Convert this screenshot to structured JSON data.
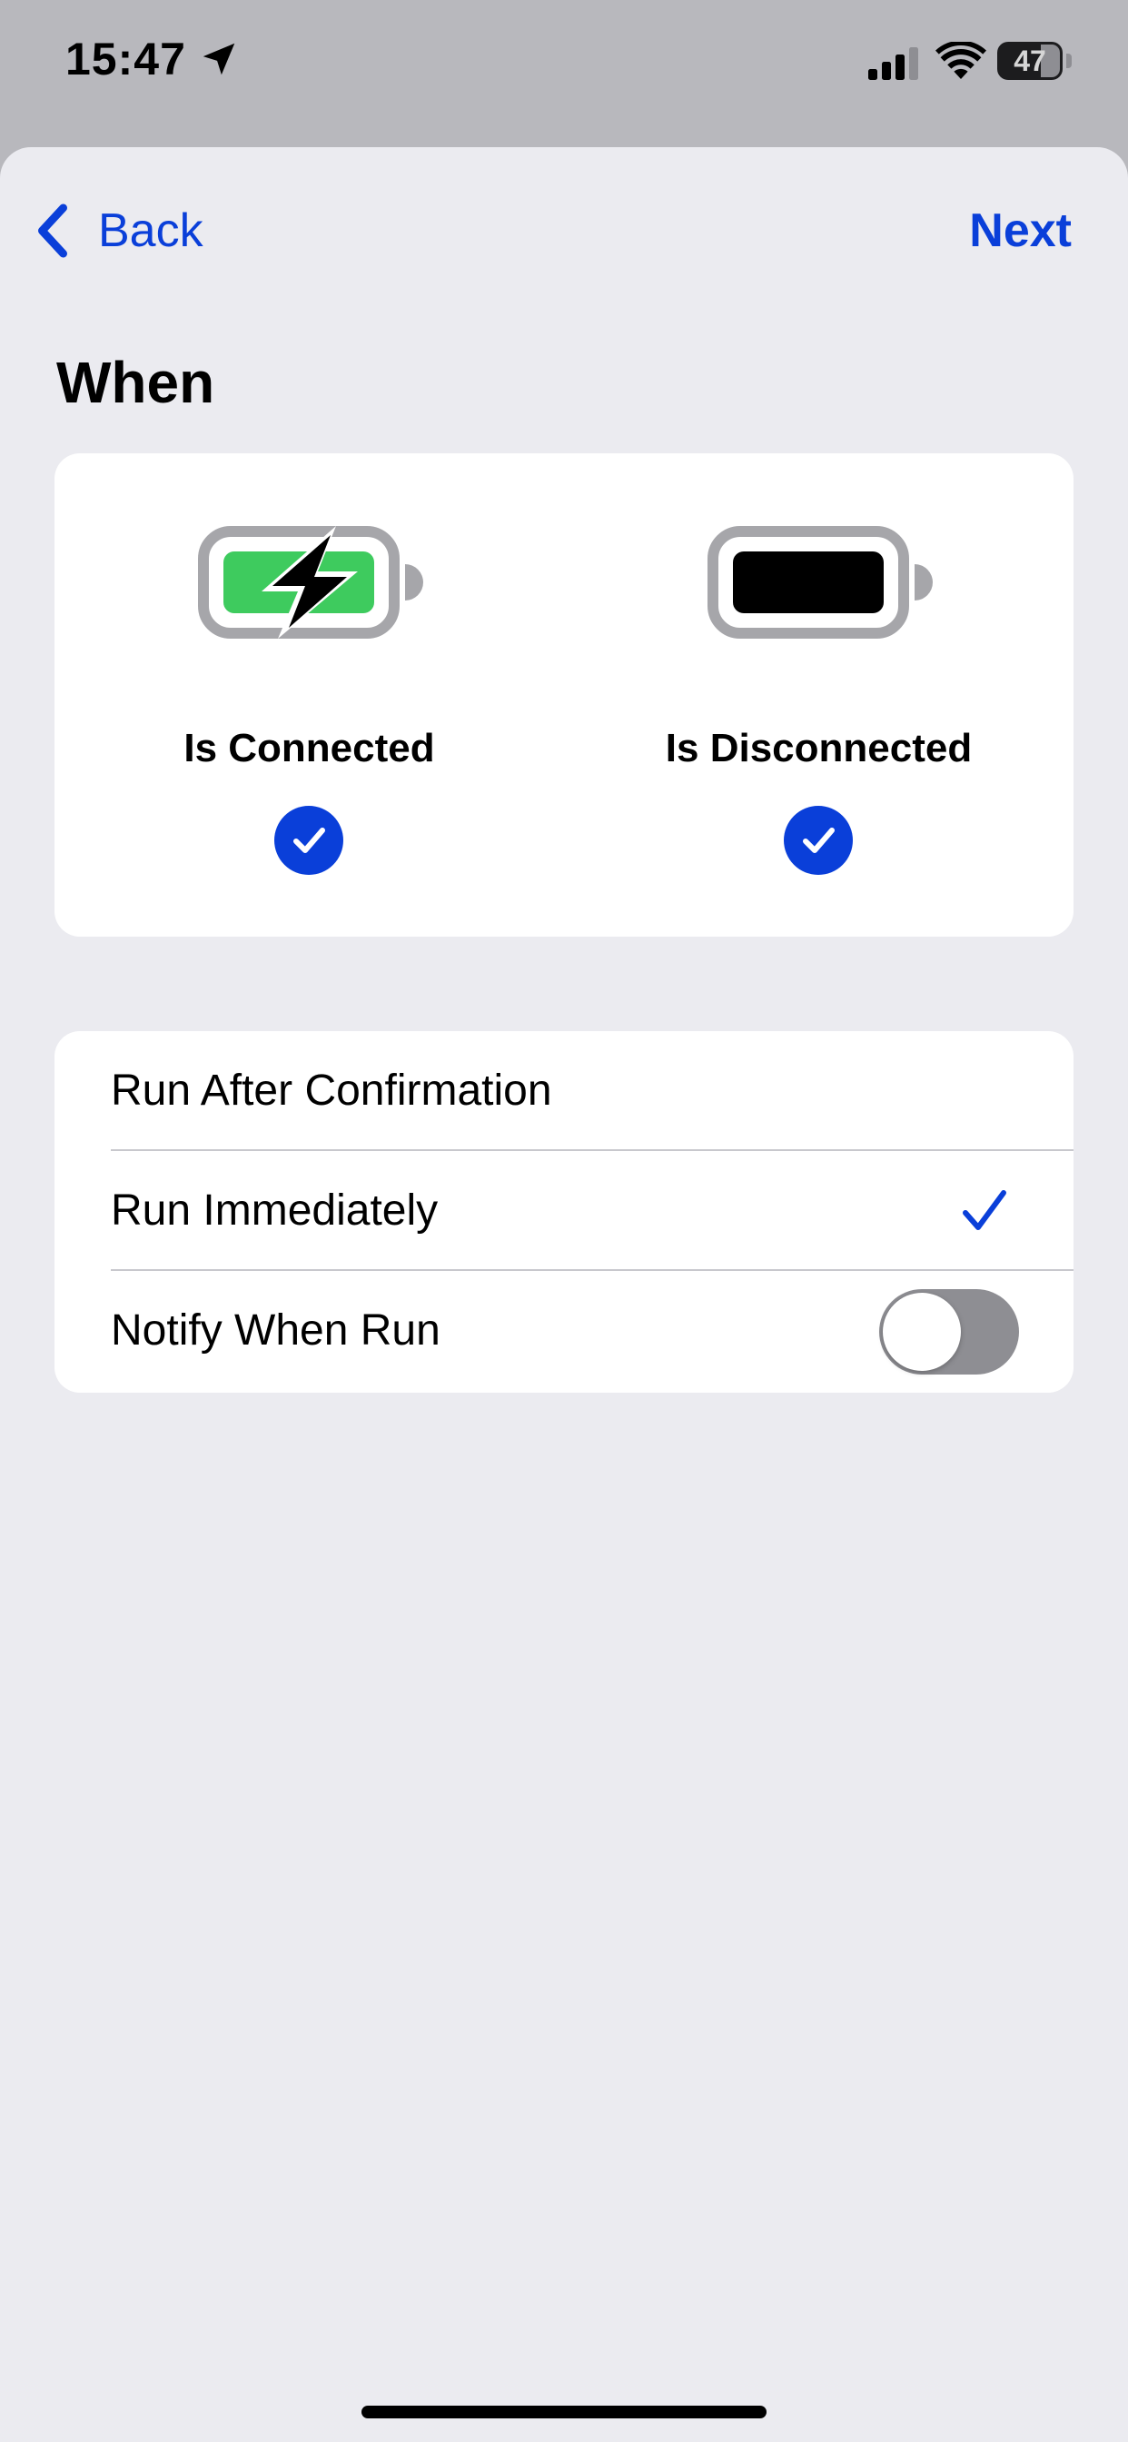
{
  "status_bar": {
    "time": "15:47",
    "battery_level": "47",
    "location_icon": "location-arrow-icon",
    "signal_icon": "cellular-signal-icon",
    "wifi_icon": "wifi-icon",
    "battery_icon": "battery-icon"
  },
  "nav": {
    "back_label": "Back",
    "next_label": "Next"
  },
  "section": {
    "title": "When"
  },
  "triggers": [
    {
      "label": "Is Connected",
      "icon": "battery-charging-icon",
      "checked": true
    },
    {
      "label": "Is Disconnected",
      "icon": "battery-full-icon",
      "checked": true
    }
  ],
  "options": {
    "run_after_confirmation": "Run After Confirmation",
    "run_immediately": "Run Immediately",
    "notify_when_run": "Notify When Run",
    "selected": "Run Immediately",
    "notify_enabled": false
  },
  "colors": {
    "accent": "#0a3fd9",
    "background": "#ebebf0",
    "card": "#ffffff",
    "charging_green": "#3ecb5e",
    "toggle_off": "#8e8e93"
  }
}
